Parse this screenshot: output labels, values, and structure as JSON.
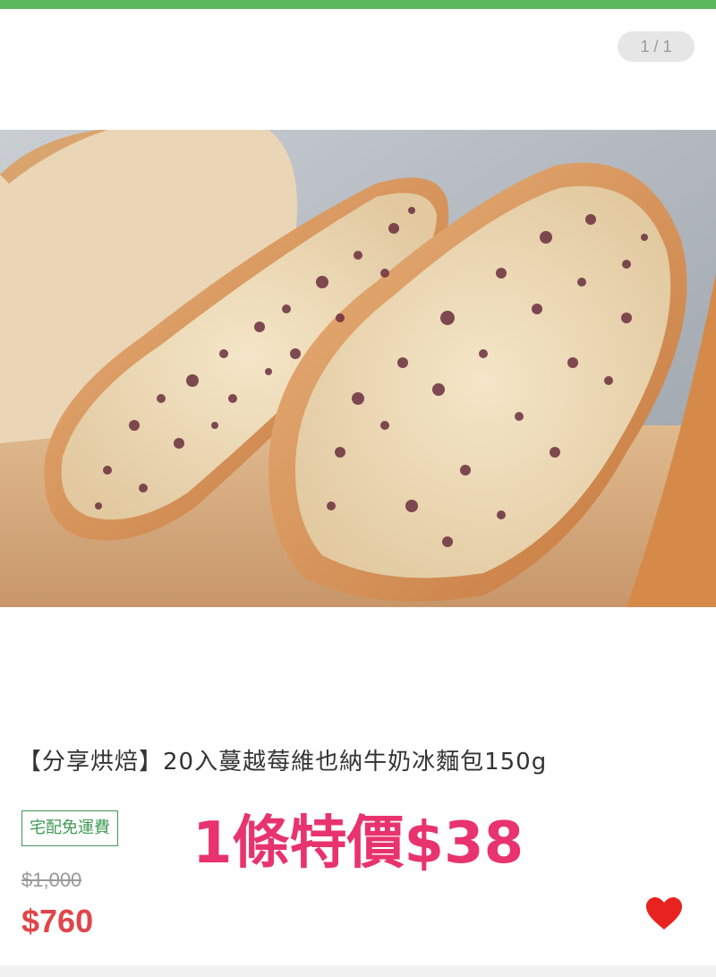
{
  "colors": {
    "top_bar": "#5cb85c",
    "promo": "#e8336f",
    "sale_price": "#e0454a",
    "badge": "#3f9a54",
    "heart": "#e8231f"
  },
  "gallery": {
    "pager": "1 / 1",
    "image_alt": "cranberry-vienna-milk-bread-photo"
  },
  "product": {
    "title": "【分享烘焙】20入蔓越莓維也納牛奶冰麵包150g",
    "shipping_badge": "宅配免運費",
    "promo_text": "1條特價$38",
    "original_price": "$1,000",
    "sale_price": "$760"
  },
  "icons": {
    "favorite": "heart-icon"
  }
}
